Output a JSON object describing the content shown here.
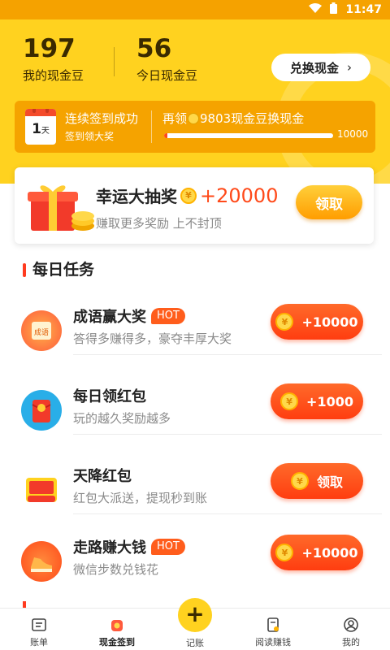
{
  "status_bar": {
    "time": "11:47"
  },
  "header": {
    "my_beans_value": "197",
    "my_beans_label": "我的现金豆",
    "today_beans_value": "56",
    "today_beans_label": "今日现金豆",
    "exchange_button": "兑换现金",
    "exchange_chevron": "›"
  },
  "signin": {
    "day_number": "1",
    "day_unit": "天",
    "title": "连续签到成功",
    "subtitle": "签到领大奖",
    "goal_prefix": "再领",
    "goal_amount": "9803现金豆换现金",
    "progress_max": "10000",
    "progress_fraction": 0.02
  },
  "lottery": {
    "title": "幸运大抽奖",
    "amount": "+20000",
    "subtitle": "赚取更多奖励 上不封顶",
    "button": "领取"
  },
  "daily_tasks": {
    "title": "每日任务",
    "items": [
      {
        "title": "成语赢大奖",
        "hot": "HOT",
        "subtitle": "答得多赚得多，豪夺丰厚大奖",
        "button": "+10000",
        "icon": "idiom-icon"
      },
      {
        "title": "每日领红包",
        "hot": "",
        "subtitle": "玩的越久奖励越多",
        "button": "+1000",
        "icon": "red-packet-icon"
      },
      {
        "title": "天降红包",
        "hot": "",
        "subtitle": "红包大派送，提现秒到账",
        "button": "领取",
        "icon": "falling-red-packet-icon"
      },
      {
        "title": "走路赚大钱",
        "hot": "HOT",
        "subtitle": "微信步数兑钱花",
        "button": "+10000",
        "icon": "shoe-icon"
      }
    ],
    "coin_symbol": "¥"
  },
  "tabbar": {
    "items": [
      {
        "label": "账单",
        "icon": "bill-icon"
      },
      {
        "label": "现金签到",
        "icon": "checkin-icon"
      },
      {
        "label": "记账",
        "icon": "plus-icon"
      },
      {
        "label": "阅读赚钱",
        "icon": "read-icon"
      },
      {
        "label": "我的",
        "icon": "profile-icon"
      }
    ],
    "add_symbol": "+"
  },
  "colors": {
    "brand_yellow": "#ffd21f",
    "accent_orange": "#f5a300",
    "action_red": "#ff4a1a"
  }
}
